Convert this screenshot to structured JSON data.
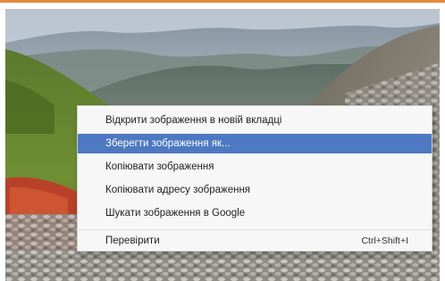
{
  "context_menu": {
    "items": [
      {
        "label": "Відкрити зображення в новій вкладці"
      },
      {
        "label": "Зберегти зображення як...",
        "selected": true
      },
      {
        "label": "Копіювати зображення"
      },
      {
        "label": "Копіювати адресу зображення"
      },
      {
        "label": "Шукати зображення в Google"
      }
    ],
    "inspect": {
      "label": "Перевірити",
      "shortcut": "Ctrl+Shift+I"
    }
  },
  "colors": {
    "frame_accent": "#e38a3f",
    "selection": "#4e79c2",
    "menu_background": "#f7f7f7"
  }
}
